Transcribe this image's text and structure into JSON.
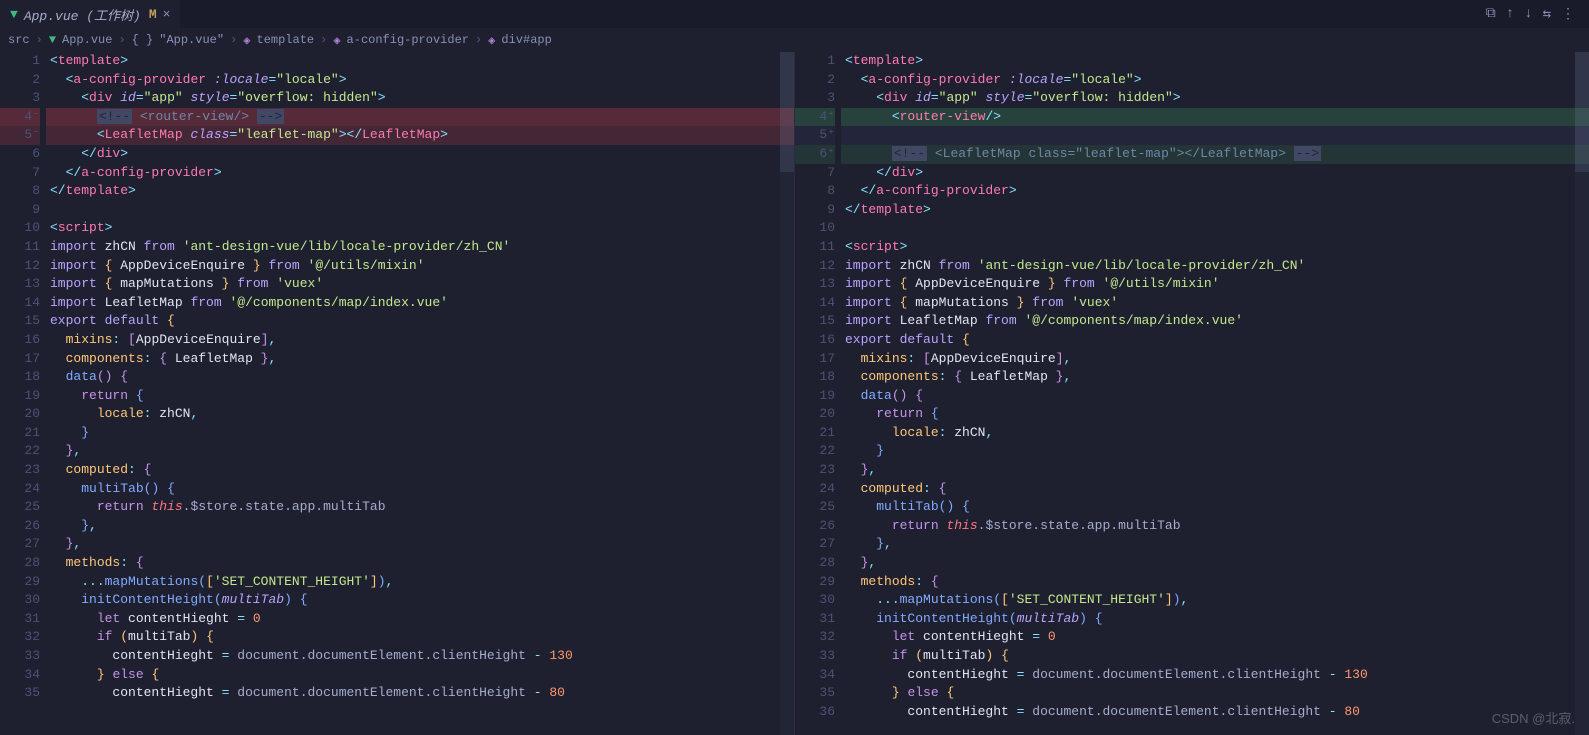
{
  "tab": {
    "filename": "App.vue (工作树)",
    "modified_marker": "M"
  },
  "breadcrumb": {
    "src": "src",
    "file": "App.vue",
    "scope": "\"App.vue\"",
    "p1": "template",
    "p2": "a-config-provider",
    "p3": "div#app"
  },
  "left": {
    "nums": [
      "1",
      "2",
      "3",
      "4⁻",
      "5⁻",
      "6",
      "7",
      "8",
      "9",
      "10",
      "11",
      "12",
      "13",
      "14",
      "15",
      "16",
      "17",
      "18",
      "19",
      "20",
      "21",
      "22",
      "23",
      "24",
      "25",
      "26",
      "27",
      "28",
      "29",
      "30",
      "31",
      "32",
      "33",
      "34",
      "35"
    ],
    "l4_comment_open": "<!--",
    "l4_comment_body": "<router-view/>",
    "l4_comment_close": "-->",
    "l5_tag": "LeafletMap",
    "l5_attr": "class",
    "l5_val": "\"leaflet-map\""
  },
  "right": {
    "nums": [
      "1",
      "2",
      "3",
      "4⁺",
      "5⁺",
      "6⁺",
      "7",
      "8",
      "9",
      "10",
      "11",
      "12",
      "13",
      "14",
      "15",
      "16",
      "17",
      "18",
      "19",
      "20",
      "21",
      "22",
      "23",
      "24",
      "25",
      "26",
      "27",
      "28",
      "29",
      "30",
      "31",
      "32",
      "33",
      "34",
      "35",
      "36"
    ],
    "l4_tag": "router-view",
    "l6_comment_open": "<!--",
    "l6_comment_body": "<LeafletMap class=\"leaflet-map\"></LeafletMap>",
    "l6_comment_close": "-->"
  },
  "common": {
    "template": "template",
    "aconfig": "a-config-provider",
    "locale_attr": ":locale",
    "locale_val": "\"locale\"",
    "div": "div",
    "id_attr": "id",
    "id_val": "\"app\"",
    "style_attr": "style",
    "style_val": "\"overflow: hidden\"",
    "script": "script",
    "import": "import",
    "from": "from",
    "export": "export",
    "default": "default",
    "zhCN": "zhCN",
    "zh_path": "'ant-design-vue/lib/locale-provider/zh_CN'",
    "AppDeviceEnquire": "AppDeviceEnquire",
    "mixin_path": "'@/utils/mixin'",
    "mapMutations": "mapMutations",
    "vuex_path": "'vuex'",
    "LeafletMap": "LeafletMap",
    "leaflet_path": "'@/components/map/index.vue'",
    "mixins": "mixins",
    "components": "components",
    "data": "data",
    "return": "return",
    "locale_key": "locale",
    "computed": "computed",
    "multiTab": "multiTab",
    "this": "this",
    "store_path": ".$store.state.app.multiTab",
    "methods": "methods",
    "spread": "...",
    "setcontent": "'SET_CONTENT_HEIGHT'",
    "initContentHeight": "initContentHeight",
    "let": "let",
    "contentHieght": "contentHieght",
    "zero": "0",
    "if": "if",
    "else": "else",
    "doc_path": "document.documentElement.clientHeight",
    "n130": "130",
    "n80": "80"
  },
  "watermark": "CSDN @北寂."
}
